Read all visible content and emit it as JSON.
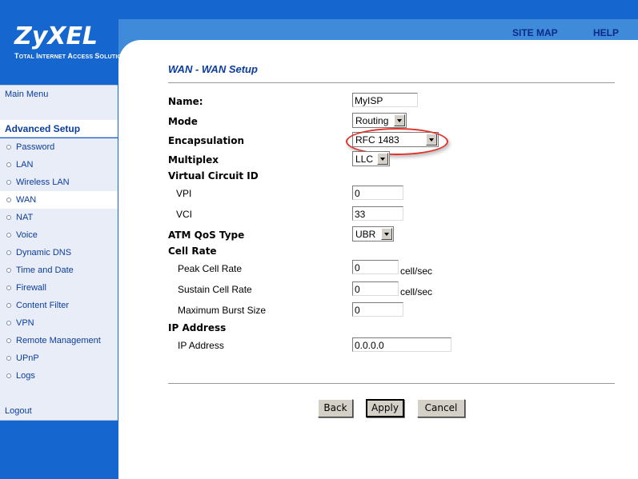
{
  "brand": {
    "logo": "ZyXEL",
    "tagline": "Total Internet Access Solution"
  },
  "top_links": {
    "site_map": "SITE MAP",
    "help": "HELP"
  },
  "sidebar": {
    "main_menu": "Main Menu",
    "section_title": "Advanced Setup",
    "items": [
      {
        "label": "Password"
      },
      {
        "label": "LAN"
      },
      {
        "label": "Wireless LAN"
      },
      {
        "label": "WAN",
        "active": true
      },
      {
        "label": "NAT"
      },
      {
        "label": "Voice"
      },
      {
        "label": "Dynamic DNS"
      },
      {
        "label": "Time and Date"
      },
      {
        "label": "Firewall"
      },
      {
        "label": "Content Filter"
      },
      {
        "label": "VPN"
      },
      {
        "label": "Remote Management"
      },
      {
        "label": "UPnP"
      },
      {
        "label": "Logs"
      }
    ],
    "logout": "Logout"
  },
  "page": {
    "title": "WAN - WAN Setup"
  },
  "form": {
    "name": {
      "label": "Name:",
      "value": "MyISP"
    },
    "mode": {
      "label": "Mode",
      "value": "Routing"
    },
    "encapsulation": {
      "label": "Encapsulation",
      "value": "RFC 1483"
    },
    "multiplex": {
      "label": "Multiplex",
      "value": "LLC"
    },
    "vc": {
      "label": "Virtual Circuit ID",
      "vpi": {
        "label": "VPI",
        "value": "0"
      },
      "vci": {
        "label": "VCI",
        "value": "33"
      }
    },
    "atm_qos": {
      "label": "ATM QoS Type",
      "value": "UBR"
    },
    "cell_rate": {
      "label": "Cell Rate",
      "peak": {
        "label": "Peak Cell Rate",
        "value": "0",
        "unit": "cell/sec"
      },
      "sustain": {
        "label": "Sustain Cell Rate",
        "value": "0",
        "unit": "cell/sec"
      },
      "burst": {
        "label": "Maximum Burst Size",
        "value": "0"
      }
    },
    "ip": {
      "label": "IP Address",
      "address": {
        "label": "IP Address",
        "value": "0.0.0.0"
      }
    }
  },
  "buttons": {
    "back": "Back",
    "apply": "Apply",
    "cancel": "Cancel"
  },
  "colors": {
    "brand_blue": "#1566cf",
    "highlight_ring": "#e0312b"
  }
}
